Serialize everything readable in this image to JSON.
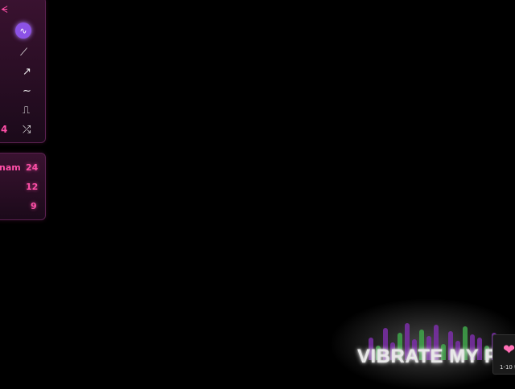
{
  "waveform_panel": {
    "header_icon": "wave-pattern-icon",
    "items": [
      {
        "icon": "sine-wave-icon",
        "glyph": "∿",
        "active": true
      },
      {
        "icon": "ramp-wave-icon",
        "glyph": "⟋"
      },
      {
        "icon": "sawtooth-wave-icon",
        "glyph": "↗"
      },
      {
        "icon": "smooth-wave-icon",
        "glyph": "∼"
      },
      {
        "icon": "square-wave-icon",
        "glyph": "⎍"
      },
      {
        "icon": "random-icon",
        "glyph": "⤮"
      }
    ],
    "left_edge_number": "4",
    "accent": "#ff4fa8",
    "active_color": "#8c52e6"
  },
  "preset_panel": {
    "rows": [
      {
        "label": "nam",
        "value": "24"
      },
      {
        "label": "",
        "value": "12"
      },
      {
        "label": "",
        "value": "9"
      }
    ]
  },
  "banner": {
    "title": "VIBRATE MY P",
    "bar_colors": [
      "#7b2fa8",
      "#3fa64a"
    ],
    "thumb_icon": "heart-icon",
    "thumb_label": "1-10 t"
  }
}
